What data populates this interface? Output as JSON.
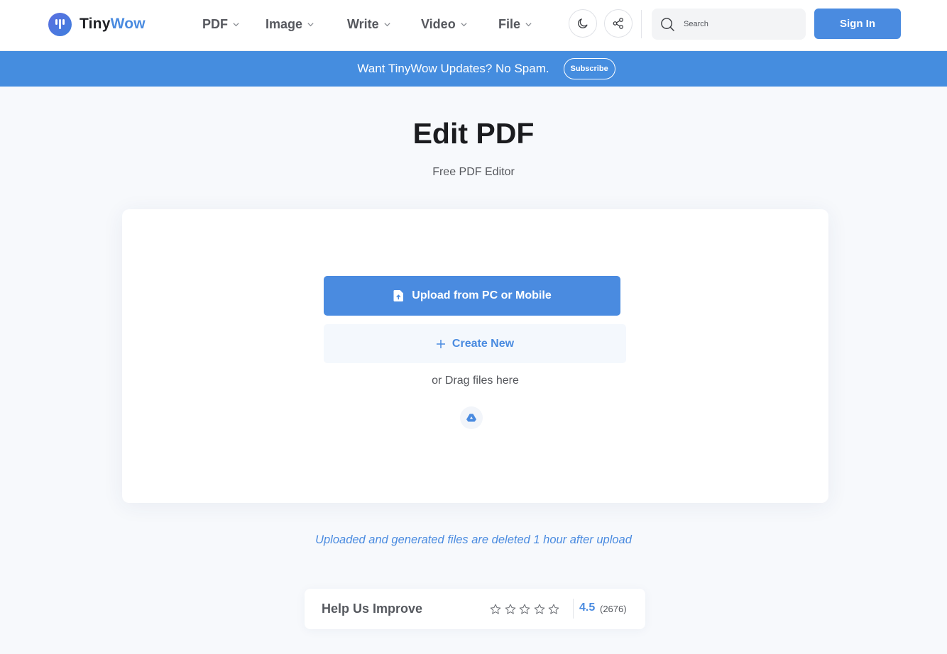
{
  "brand": {
    "name_part1": "Tiny",
    "name_part2": "Wow",
    "accent_color": "#4a8be0"
  },
  "nav": {
    "items": [
      {
        "label": "PDF"
      },
      {
        "label": "Image"
      },
      {
        "label": "Write"
      },
      {
        "label": "Video"
      },
      {
        "label": "File"
      }
    ]
  },
  "header": {
    "search_placeholder": "Search",
    "signin_label": "Sign In",
    "icons": [
      "moon-icon",
      "share-icon",
      "search-icon"
    ]
  },
  "banner": {
    "text": "Want TinyWow Updates? No Spam.",
    "subscribe_label": "Subscribe",
    "color": "#458ddf"
  },
  "page": {
    "title": "Edit PDF",
    "subtitle": "Free PDF Editor"
  },
  "uploader": {
    "upload_label": "Upload from PC or Mobile",
    "create_label": "Create New",
    "drag_text": "or Drag files here"
  },
  "notice": "Uploaded and generated files are deleted 1 hour after upload",
  "rating": {
    "label": "Help Us Improve",
    "score": "4.5",
    "count": "(2676)",
    "stars_total": 5
  }
}
